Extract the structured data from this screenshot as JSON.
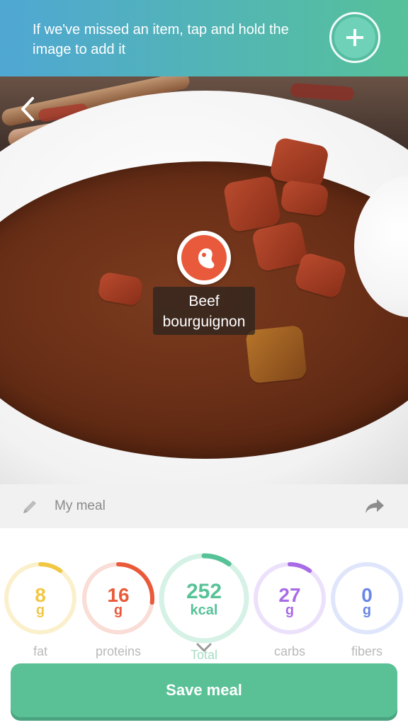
{
  "banner": {
    "text": "If we've missed an item, tap and hold the image to add it",
    "add_icon": "plus-icon"
  },
  "photo": {
    "back_icon": "chevron-left-icon",
    "food_item": {
      "icon": "meat-icon",
      "label": "Beef bourguignon"
    }
  },
  "meal": {
    "edit_icon": "pencil-icon",
    "name": "My meal",
    "share_icon": "share-icon"
  },
  "nutrients": [
    {
      "key": "fat",
      "value": "8",
      "unit": "g",
      "label": "fat",
      "color": "#f2c744",
      "track": "#fbf0cc",
      "progress": 0.1
    },
    {
      "key": "proteins",
      "value": "16",
      "unit": "g",
      "label": "proteins",
      "color": "#ea5a3a",
      "track": "#f9ddd6",
      "progress": 0.27
    },
    {
      "key": "total",
      "value": "252",
      "unit": "kcal",
      "label": "Total",
      "color": "#57c298",
      "track": "#d6f1e6",
      "progress": 0.1
    },
    {
      "key": "carbs",
      "value": "27",
      "unit": "g",
      "label": "carbs",
      "color": "#a86ce6",
      "track": "#ece1fb",
      "progress": 0.1
    },
    {
      "key": "fibers",
      "value": "0",
      "unit": "g",
      "label": "fibers",
      "color": "#6a86e6",
      "track": "#dfe6fb",
      "progress": 0.0
    }
  ],
  "actions": {
    "save_label": "Save meal"
  },
  "colors": {
    "banner_start": "#4fa7d3",
    "banner_end": "#56c19a",
    "save_button": "#5ac196"
  }
}
